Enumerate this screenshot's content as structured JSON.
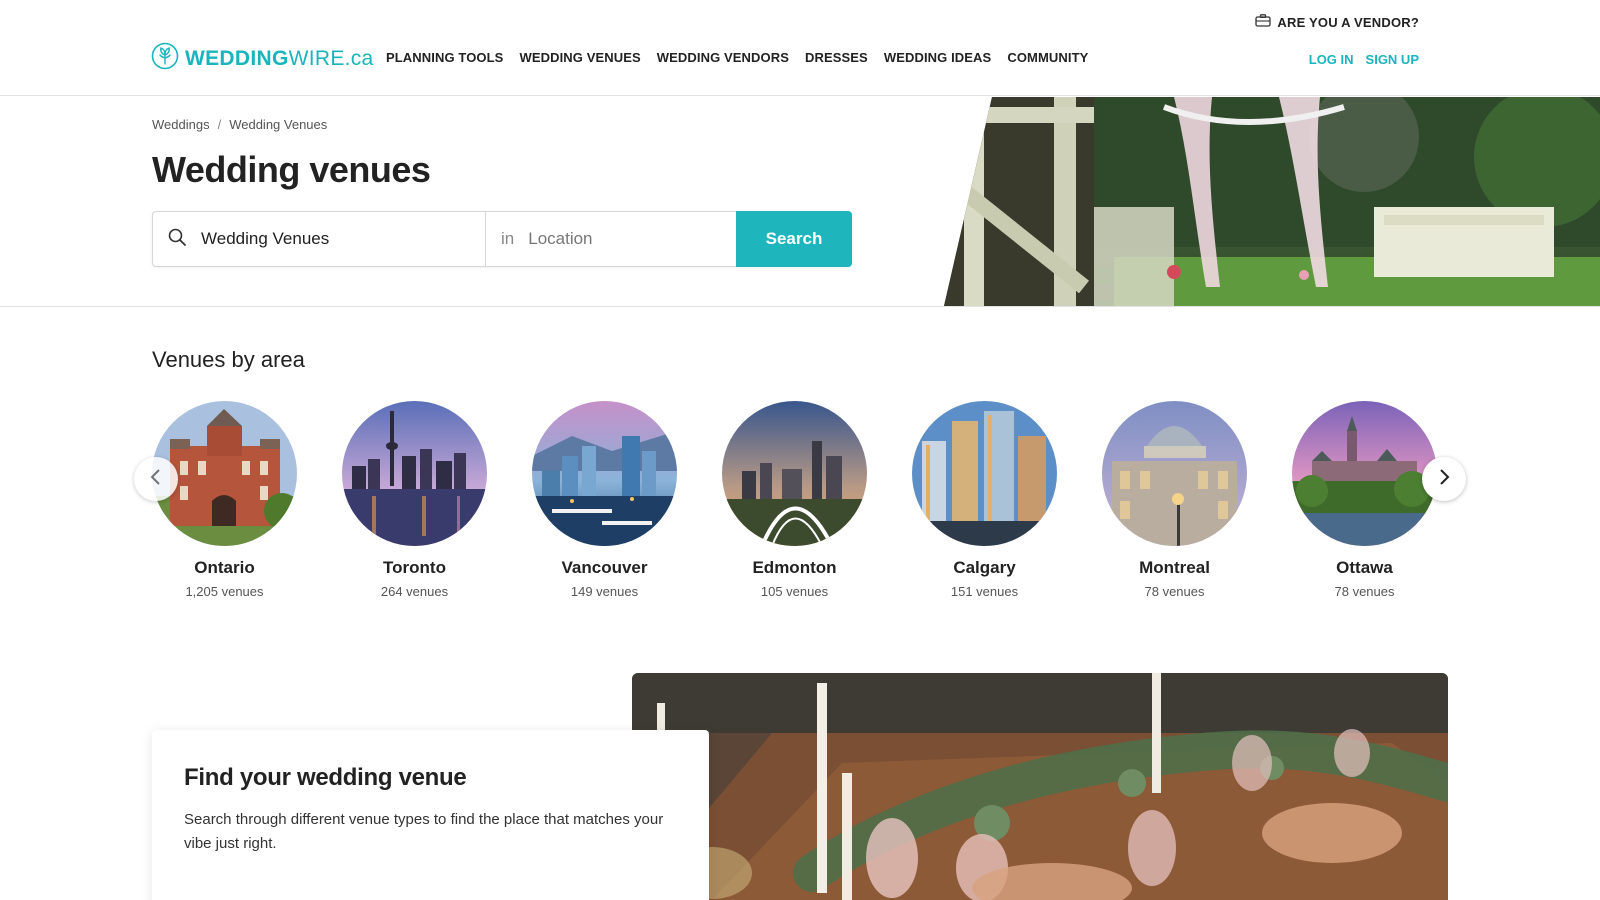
{
  "header": {
    "vendor_label": "ARE YOU A VENDOR?",
    "logo": {
      "brand_bold": "WEDDING",
      "brand_light": "WIRE.ca"
    },
    "nav": [
      "PLANNING TOOLS",
      "WEDDING VENUES",
      "WEDDING VENDORS",
      "DRESSES",
      "WEDDING IDEAS",
      "COMMUNITY"
    ],
    "login_label": "LOG IN",
    "signup_label": "SIGN UP",
    "accent_color": "#19b5bc"
  },
  "hero": {
    "breadcrumb": [
      "Weddings",
      "Wedding Venues"
    ],
    "breadcrumb_sep": "/",
    "title": "Wedding venues",
    "search": {
      "query_value": "Wedding Venues",
      "in_label": "in",
      "location_placeholder": "Location",
      "button_label": "Search"
    }
  },
  "areas": {
    "title": "Venues by area",
    "items": [
      {
        "name": "Ontario",
        "count": "1,205 venues"
      },
      {
        "name": "Toronto",
        "count": "264 venues"
      },
      {
        "name": "Vancouver",
        "count": "149 venues"
      },
      {
        "name": "Edmonton",
        "count": "105 venues"
      },
      {
        "name": "Calgary",
        "count": "151 venues"
      },
      {
        "name": "Montreal",
        "count": "78 venues"
      },
      {
        "name": "Ottawa",
        "count": "78 venues"
      }
    ]
  },
  "feature": {
    "title": "Find your wedding venue",
    "description": "Search through different venue types to find the place that matches your vibe just right."
  }
}
